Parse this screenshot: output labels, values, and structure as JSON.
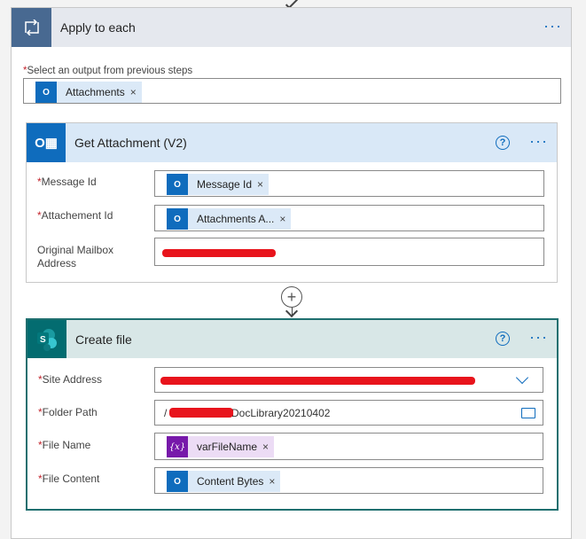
{
  "apply_each": {
    "title": "Apply to each",
    "select_label": "Select an output from previous steps",
    "token": "Attachments"
  },
  "get_attachment": {
    "title": "Get Attachment (V2)",
    "fields": [
      {
        "label": "Message Id",
        "required": true,
        "token": "Message Id"
      },
      {
        "label": "Attachement Id",
        "required": true,
        "token": "Attachments A..."
      },
      {
        "label": "Original Mailbox Address",
        "required": false
      }
    ]
  },
  "create_file": {
    "title": "Create file",
    "fields": [
      {
        "label": "Site Address",
        "required": true
      },
      {
        "label": "Folder Path",
        "required": true,
        "value_prefix": "/",
        "value_suffix": "DocLibrary20210402"
      },
      {
        "label": "File Name",
        "required": true,
        "token": "varFileName"
      },
      {
        "label": "File Content",
        "required": true,
        "token": "Content Bytes"
      }
    ]
  },
  "common": {
    "asterisk": "*",
    "close": "×",
    "more": "···",
    "help": "?",
    "var_icon": "{x}"
  },
  "colors": {
    "accent": "#0f6cbd",
    "apply_icon": "#486991",
    "sharepoint": "#036c70",
    "redaction": "#e8141c"
  }
}
